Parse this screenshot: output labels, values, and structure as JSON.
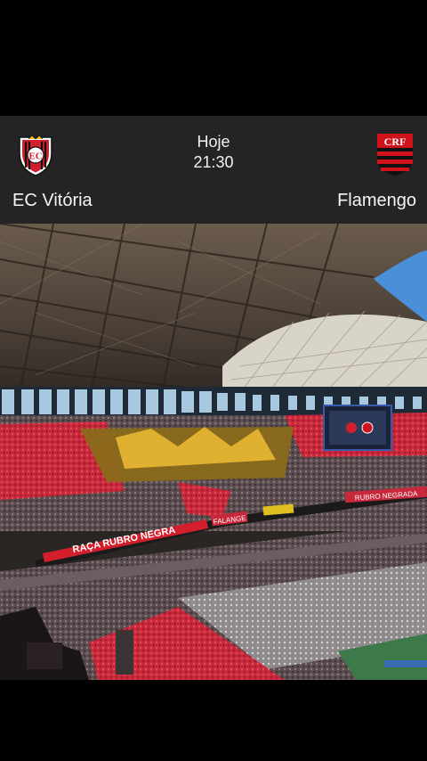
{
  "match": {
    "home_team": "EC Vitória",
    "away_team": "Flamengo",
    "day": "Hoje",
    "time": "21:30",
    "home_crest_icon": "ec-vitoria-crest-icon",
    "away_crest_icon": "flamengo-crest-icon"
  },
  "media": {
    "banner_text": "RAÇA RUBRO NEGRA",
    "banner_small": "FALANGE",
    "banner_right": "RUBRO NEGRADA"
  },
  "colors": {
    "card_bg": "#242424",
    "vitoria_red": "#d21f2b",
    "flamengo_red": "#d0121b",
    "crowd_red": "#c8283a"
  }
}
